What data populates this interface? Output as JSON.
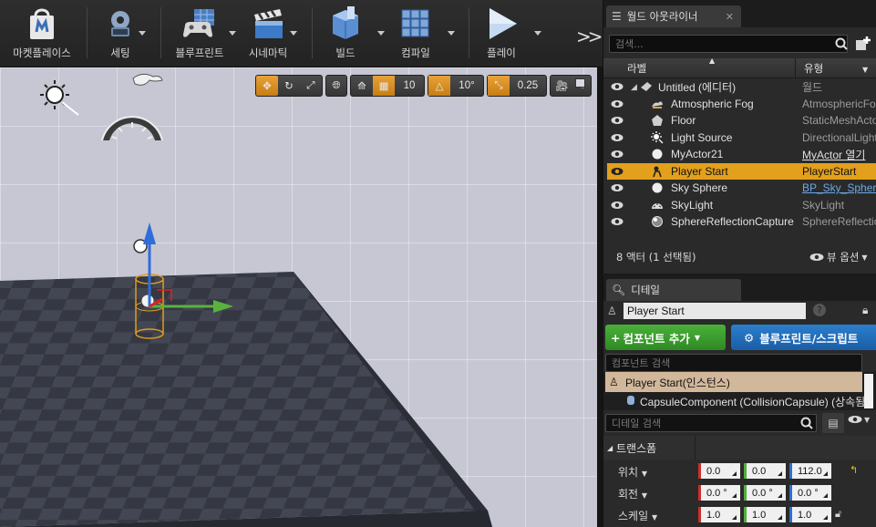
{
  "toolbar": {
    "marketplace": "마켓플레이스",
    "settings": "세팅",
    "blueprints": "블루프린트",
    "cinematics": "시네마틱",
    "build": "빌드",
    "compile": "컴파일",
    "play": "플레이"
  },
  "viewport": {
    "grid_snap": "10",
    "rotation_snap": "10°",
    "scale_snap": "0.25",
    "camera_speed": "4"
  },
  "outliner": {
    "tab_title": "월드 아웃라이너",
    "search_placeholder": "검색...",
    "col_label": "라벨",
    "col_type": "유형",
    "rows": [
      {
        "name": "Untitled (에디터)",
        "type": "월드"
      },
      {
        "name": "Atmospheric Fog",
        "type": "AtmosphericFog"
      },
      {
        "name": "Floor",
        "type": "StaticMeshActor"
      },
      {
        "name": "Light Source",
        "type": "DirectionalLight"
      },
      {
        "name": "MyActor21",
        "type": "MyActor 열기"
      },
      {
        "name": "Player Start",
        "type": "PlayerStart"
      },
      {
        "name": "Sky Sphere",
        "type": "BP_Sky_Sphere"
      },
      {
        "name": "SkyLight",
        "type": "SkyLight"
      },
      {
        "name": "SphereReflectionCapture",
        "type": "SphereReflectionCapture"
      }
    ],
    "footer_count": "8 액터 (1 선택됨)",
    "view_options": "뷰 옵션"
  },
  "details": {
    "tab_title": "디테일",
    "actor_name": "Player Start",
    "add_component": "컴포넌트 추가",
    "blueprint_button": "블루프린트/스크립트",
    "component_search": "컴포넌트 검색",
    "root_component": "Player Start(인스턴스)",
    "child_component": "CapsuleComponent (CollisionCapsule) (상속됨)",
    "details_search": "디테일 검색",
    "transform_section": "트랜스폼",
    "location_label": "위치",
    "rotation_label": "회전",
    "scale_label": "스케일",
    "location": [
      "0.0",
      "0.0",
      "112.0"
    ],
    "rotation": [
      "0.0 °",
      "0.0 °",
      "0.0 °"
    ],
    "scale": [
      "1.0",
      "1.0",
      "1.0"
    ]
  },
  "colors": {
    "selection": "#e3a01c",
    "add_button": "#3f9f31",
    "blueprint_button": "#2374c0",
    "viewport_bg": "#c6c7d3",
    "floor": "#3c404b"
  }
}
